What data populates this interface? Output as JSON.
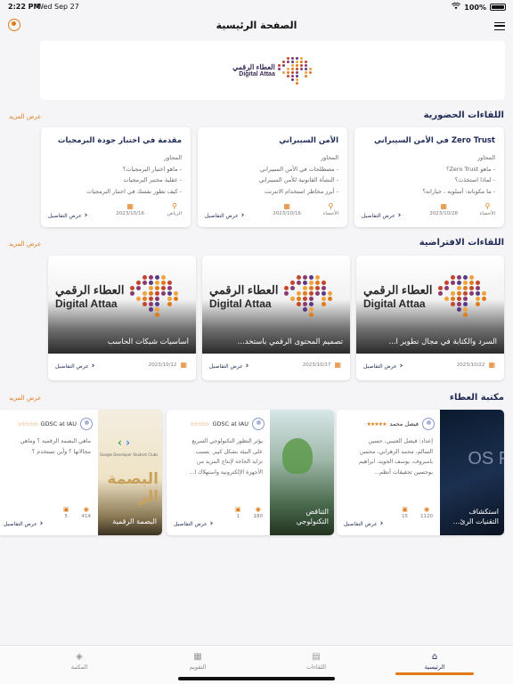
{
  "status_bar": {
    "time": "2:22 PM",
    "date": "Wed Sep 27",
    "battery": "100%"
  },
  "header": {
    "title": "الصفحة الرئيسية"
  },
  "banner": {
    "logo_ar": "العطاء الرقمي",
    "logo_en": "Digital Attaa"
  },
  "sections": {
    "in_person": {
      "title": "اللقاءات الحضورية",
      "more": "عرض المزيد",
      "cards": [
        {
          "title": "Zero Trust في الأمن السيبراني",
          "lines": [
            "المحاور",
            "- ماهو Zero Trust؟",
            "- لماذا استخدَث؟",
            "- ما مكوناته: أسلوبه ، خياراته؟"
          ],
          "location": "الأحساء",
          "date": "2023/10/28",
          "details": "عرض التفاصيل"
        },
        {
          "title": "الأمن السيبراني",
          "lines": [
            "المحاور",
            "- مصطلحات في الأمن السيبراني",
            "- النشأة القانونية للأمن السيبراني",
            "- أبرز مخاطر استخدام الانترنت"
          ],
          "location": "الأحساء",
          "date": "2023/10/16",
          "details": "عرض التفاصيل"
        },
        {
          "title": "مقدمة في اختبار جودة البرمجيات",
          "lines": [
            "المحاور",
            "- ماهو اختبار البرمجيات؟",
            "- عقلية مختبر البرمجيات",
            "- كيف تطور نفسك في اختبار البرمجيات"
          ],
          "location": "الرياض",
          "date": "2023/10/16",
          "details": "عرض التفاصيل"
        }
      ]
    },
    "virtual": {
      "title": "اللقاءات الافتراضية",
      "more": "عرض المزيد",
      "cards": [
        {
          "title": "السرد والكتابة في مجال تطوير ا...",
          "date": "2023/10/22",
          "details": "عرض التفاصيل"
        },
        {
          "title": "تصميم المحتوى الرقمي باستخد...",
          "date": "2023/10/17",
          "details": "عرض التفاصيل"
        },
        {
          "title": "أساسيات شبكات الحاسب",
          "date": "2023/10/12",
          "details": "عرض التفاصيل"
        }
      ]
    },
    "library": {
      "title": "مكتبة العطاء",
      "more": "عرض المزيد",
      "cards": [
        {
          "image_title": "استكشاف التقنيات الرئ...",
          "author": "فيصل محمد",
          "stars": "★★★★★",
          "desc": [
            "إعداد: فيصل العتيبي، حسين",
            "السالم، محمد الزهراني، محسن",
            "بامبروف، يوسف الجويد، ابراهيم",
            "بوحسين    تحقيقات أنظم..."
          ],
          "views": "1120",
          "comments": "15",
          "details": "عرض التفاصيل"
        },
        {
          "image_title": "التناقض التكنولوجي",
          "author": "GDSC at IAU",
          "stars": "☆☆☆☆☆",
          "desc": [
            "يؤثر التطور التكنولوجي السريع",
            "على البيئة بشكل كبير. بسبب",
            "تزايد الحاجة لإنتاج المزيد من",
            "الأجهزة الإلكترونية واستهلاك ا..."
          ],
          "views": "180",
          "comments": "1",
          "details": "عرض التفاصيل"
        },
        {
          "image_title": "البصمة الرقمية",
          "author": "GDSC at IAU",
          "stars": "☆☆☆☆☆",
          "desc": [
            "ماهي البصمة الرقمية ؟ وماهي",
            "مجالاتها ؟ وأين تستخدم ؟"
          ],
          "views": "414",
          "comments": "5",
          "details": "عرض التفاصيل"
        }
      ]
    }
  },
  "tabs": [
    {
      "label": "الرئيسية",
      "icon": "home-icon",
      "active": true
    },
    {
      "label": "اللقاءات",
      "icon": "meetings-icon",
      "active": false
    },
    {
      "label": "التقويم",
      "icon": "calendar-icon",
      "active": false
    },
    {
      "label": "المكتبة",
      "icon": "library-icon",
      "active": false
    }
  ],
  "colors": {
    "accent": "#e07b1a",
    "primary": "#1e2a55",
    "background": "#f5f5f7"
  }
}
